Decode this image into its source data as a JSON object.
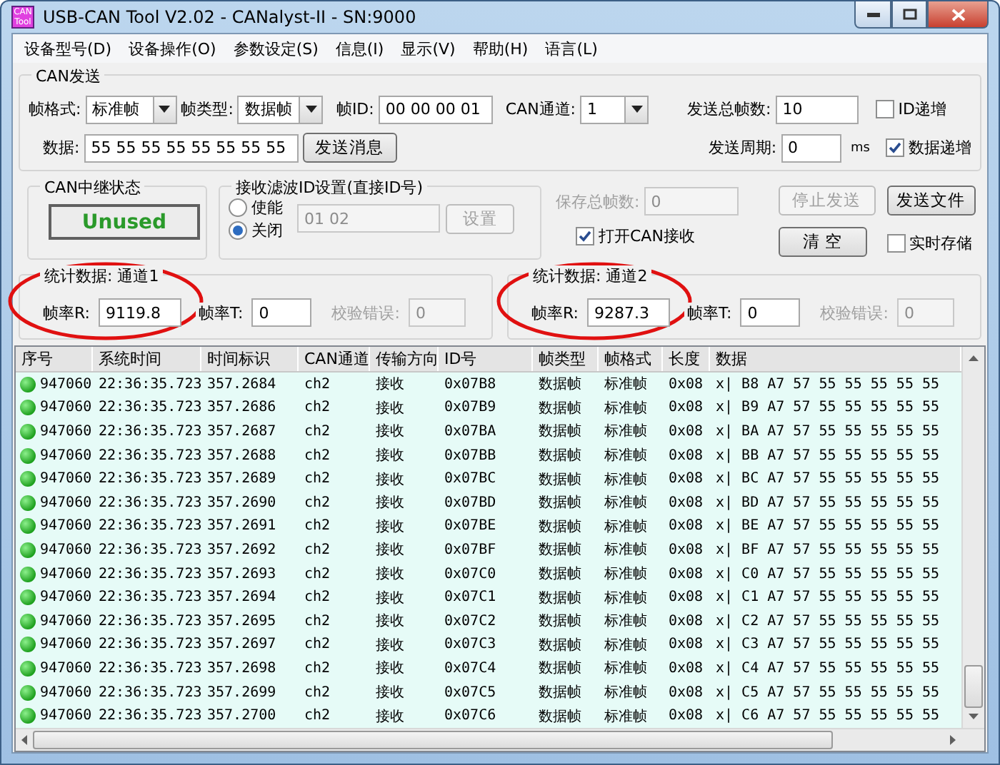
{
  "window": {
    "title": "USB-CAN Tool V2.02 - CANalyst-II - SN:9000",
    "logo": "CAN Tool"
  },
  "menu": [
    "设备型号(D)",
    "设备操作(O)",
    "参数设定(S)",
    "信息(I)",
    "显示(V)",
    "帮助(H)",
    "语言(L)"
  ],
  "send": {
    "legend": "CAN发送",
    "frame_format": {
      "label": "帧格式:",
      "value": "标准帧"
    },
    "frame_type": {
      "label": "帧类型:",
      "value": "数据帧"
    },
    "frame_id": {
      "label": "帧ID:",
      "value": "00 00 00 01"
    },
    "channel": {
      "label": "CAN通道:",
      "value": "1"
    },
    "total": {
      "label": "发送总帧数:",
      "value": "10"
    },
    "id_increment": {
      "label": "ID递增",
      "checked": false
    },
    "data": {
      "label": "数据:",
      "value": "55 55 55 55 55 55 55 55"
    },
    "send_button": "发送消息",
    "period": {
      "label": "发送周期:",
      "value": "0",
      "unit": "ms"
    },
    "data_increment": {
      "label": "数据递增",
      "checked": true
    }
  },
  "relay": {
    "legend": "CAN中继状态",
    "status": "Unused"
  },
  "filter": {
    "legend": "接收滤波ID设置(直接ID号)",
    "options": [
      {
        "label": "使能",
        "selected": false
      },
      {
        "label": "关闭",
        "selected": true
      }
    ],
    "ids": {
      "value": "01 02",
      "disabled": true
    },
    "set_button": {
      "label": "设置",
      "disabled": true
    }
  },
  "receive": {
    "saved_total": {
      "label": "保存总帧数:",
      "value": "0",
      "disabled": true
    },
    "open_receive": {
      "label": "打开CAN接收",
      "checked": true
    },
    "stop_button": {
      "label": "停止发送",
      "disabled": true
    },
    "file_button": {
      "label": "发送文件",
      "disabled": false
    },
    "clear_button": {
      "label": "清 空",
      "disabled": false
    },
    "realtime_save": {
      "label": "实时存储",
      "checked": false
    }
  },
  "stats": [
    {
      "title": "统计数据: 通道1",
      "circled": true,
      "rate_r": {
        "label": "帧率R:",
        "value": "9119.8"
      },
      "rate_t": {
        "label": "帧率T:",
        "value": "0"
      },
      "check_errors": {
        "label": "校验错误:",
        "value": "0",
        "disabled": true
      }
    },
    {
      "title": "统计数据: 通道2",
      "circled": true,
      "rate_r": {
        "label": "帧率R:",
        "value": "9287.3"
      },
      "rate_t": {
        "label": "帧率T:",
        "value": "0"
      },
      "check_errors": {
        "label": "校验错误:",
        "value": "0",
        "disabled": true
      }
    }
  ],
  "table": {
    "columns": [
      "序号",
      "系统时间",
      "时间标识",
      "CAN通道",
      "传输方向",
      "ID号",
      "帧类型",
      "帧格式",
      "长度",
      "数据"
    ],
    "rows": [
      [
        "947060",
        "22:36:35.723",
        "357.2684",
        "ch2",
        "接收",
        "0x07B8",
        "数据帧",
        "标准帧",
        "0x08",
        "x| B8 A7 57 55 55 55 55 55"
      ],
      [
        "947060",
        "22:36:35.723",
        "357.2686",
        "ch2",
        "接收",
        "0x07B9",
        "数据帧",
        "标准帧",
        "0x08",
        "x| B9 A7 57 55 55 55 55 55"
      ],
      [
        "947060",
        "22:36:35.723",
        "357.2687",
        "ch2",
        "接收",
        "0x07BA",
        "数据帧",
        "标准帧",
        "0x08",
        "x| BA A7 57 55 55 55 55 55"
      ],
      [
        "947060",
        "22:36:35.723",
        "357.2688",
        "ch2",
        "接收",
        "0x07BB",
        "数据帧",
        "标准帧",
        "0x08",
        "x| BB A7 57 55 55 55 55 55"
      ],
      [
        "947060",
        "22:36:35.723",
        "357.2689",
        "ch2",
        "接收",
        "0x07BC",
        "数据帧",
        "标准帧",
        "0x08",
        "x| BC A7 57 55 55 55 55 55"
      ],
      [
        "947060",
        "22:36:35.723",
        "357.2690",
        "ch2",
        "接收",
        "0x07BD",
        "数据帧",
        "标准帧",
        "0x08",
        "x| BD A7 57 55 55 55 55 55"
      ],
      [
        "947060",
        "22:36:35.723",
        "357.2691",
        "ch2",
        "接收",
        "0x07BE",
        "数据帧",
        "标准帧",
        "0x08",
        "x| BE A7 57 55 55 55 55 55"
      ],
      [
        "947060",
        "22:36:35.723",
        "357.2692",
        "ch2",
        "接收",
        "0x07BF",
        "数据帧",
        "标准帧",
        "0x08",
        "x| BF A7 57 55 55 55 55 55"
      ],
      [
        "947060",
        "22:36:35.723",
        "357.2693",
        "ch2",
        "接收",
        "0x07C0",
        "数据帧",
        "标准帧",
        "0x08",
        "x| C0 A7 57 55 55 55 55 55"
      ],
      [
        "947060",
        "22:36:35.723",
        "357.2694",
        "ch2",
        "接收",
        "0x07C1",
        "数据帧",
        "标准帧",
        "0x08",
        "x| C1 A7 57 55 55 55 55 55"
      ],
      [
        "947060",
        "22:36:35.723",
        "357.2695",
        "ch2",
        "接收",
        "0x07C2",
        "数据帧",
        "标准帧",
        "0x08",
        "x| C2 A7 57 55 55 55 55 55"
      ],
      [
        "947060",
        "22:36:35.723",
        "357.2697",
        "ch2",
        "接收",
        "0x07C3",
        "数据帧",
        "标准帧",
        "0x08",
        "x| C3 A7 57 55 55 55 55 55"
      ],
      [
        "947060",
        "22:36:35.723",
        "357.2698",
        "ch2",
        "接收",
        "0x07C4",
        "数据帧",
        "标准帧",
        "0x08",
        "x| C4 A7 57 55 55 55 55 55"
      ],
      [
        "947060",
        "22:36:35.723",
        "357.2699",
        "ch2",
        "接收",
        "0x07C5",
        "数据帧",
        "标准帧",
        "0x08",
        "x| C5 A7 57 55 55 55 55 55"
      ],
      [
        "947060",
        "22:36:35.723",
        "357.2700",
        "ch2",
        "接收",
        "0x07C6",
        "数据帧",
        "标准帧",
        "0x08",
        "x| C6 A7 57 55 55 55 55 55"
      ]
    ]
  }
}
